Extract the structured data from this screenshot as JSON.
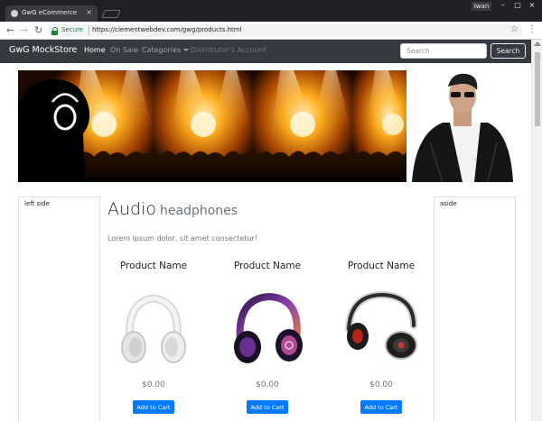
{
  "browser": {
    "tab_title": "GwG eCommerce",
    "tab_close": "×",
    "user": "Iwan",
    "window_controls": {
      "minimize": "–",
      "maximize": "□",
      "close": "×"
    },
    "security_label": "Secure",
    "url": "https://clementwebdev.com/gwg/products.html",
    "nav_icons": {
      "back": "←",
      "forward": "→",
      "reload": "↻",
      "star": "☆",
      "menu": "⋮"
    }
  },
  "navbar": {
    "brand": "GwG MockStore",
    "links": [
      "Home",
      "On Sale",
      "Categories",
      "Distributor's Account"
    ],
    "active_link": "Home",
    "search_placeholder": "Search",
    "search_button": "Search"
  },
  "colors": {
    "navbar_bg": "#343a40",
    "primary": "#007bff",
    "secure_green": "#188038"
  },
  "sidebar_left": {
    "label": "left side"
  },
  "sidebar_right": {
    "label": "aside"
  },
  "main": {
    "title_main": "Audio",
    "title_sub": "headphones",
    "description": "Lorem ipsum dolor, sit amet consectetur!"
  },
  "products": [
    {
      "name": "Product Name",
      "price": "$0.00",
      "button": "Add to Cart",
      "image": "white-headphones-icon",
      "color": "#e8e8e8"
    },
    {
      "name": "Product Name",
      "price": "$0.00",
      "button": "Add to Cart",
      "image": "purple-beats-headphones-icon",
      "color": "#5b2a86"
    },
    {
      "name": "Product Name",
      "price": "$0.00",
      "button": "Add to Cart",
      "image": "black-red-headphones-icon",
      "color": "#1e1e1e"
    }
  ]
}
